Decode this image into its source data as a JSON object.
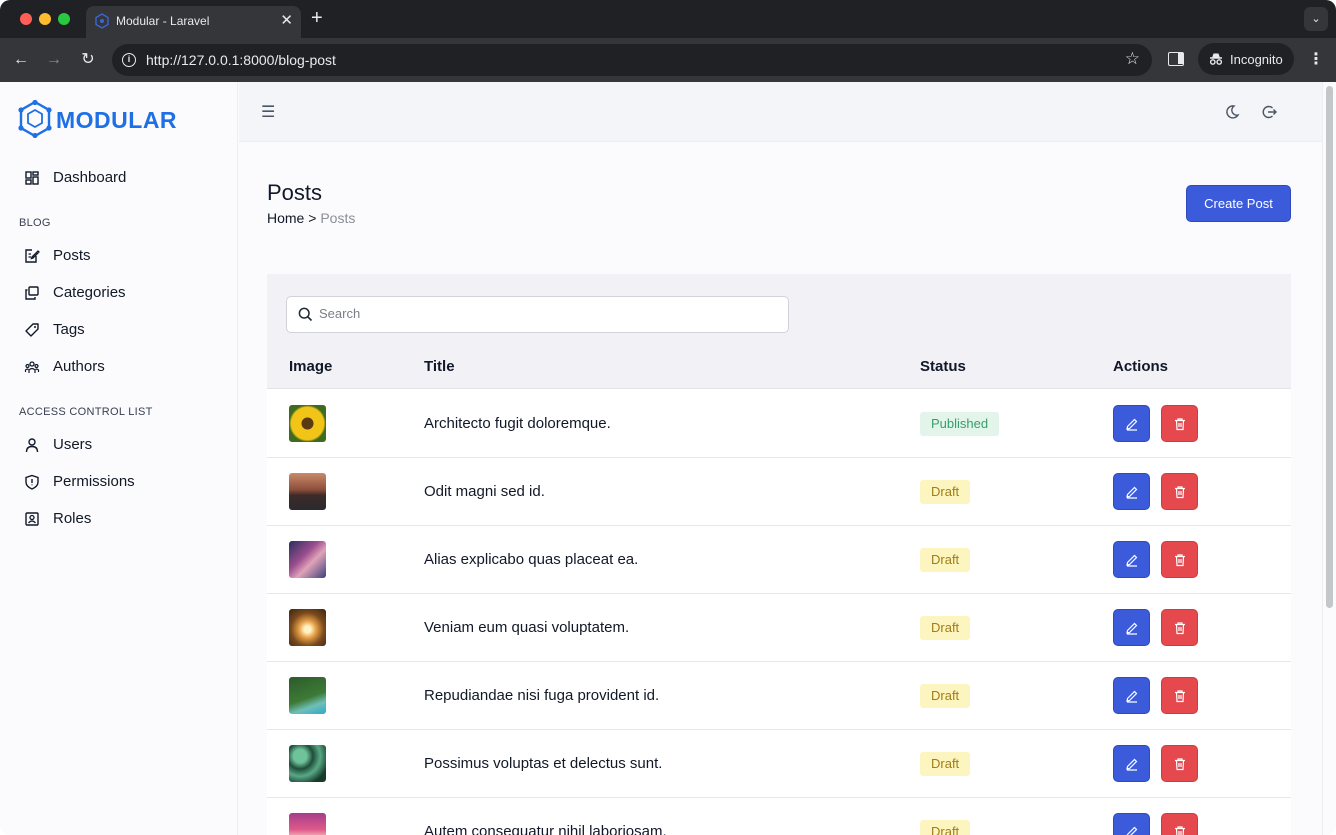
{
  "browser": {
    "tab_title": "Modular - Laravel",
    "tab_close": "✕",
    "new_tab": "+",
    "url": "http://127.0.0.1:8000/blog-post",
    "profile_label": "Incognito"
  },
  "sidebar": {
    "logo_text": "MODULAR",
    "dashboard": "Dashboard",
    "sections": [
      "BLOG",
      "ACCESS CONTROL LIST"
    ],
    "blog_items": [
      {
        "label": "Posts",
        "icon": "edit-note-icon"
      },
      {
        "label": "Categories",
        "icon": "copy-icon"
      },
      {
        "label": "Tags",
        "icon": "tag-icon"
      },
      {
        "label": "Authors",
        "icon": "users-group-icon"
      }
    ],
    "acl_items": [
      {
        "label": "Users",
        "icon": "user-icon"
      },
      {
        "label": "Permissions",
        "icon": "shield-icon"
      },
      {
        "label": "Roles",
        "icon": "id-badge-icon"
      }
    ]
  },
  "header": {
    "menu_icon": "hamburger-icon",
    "theme_icon": "moon-icon",
    "logout_icon": "logout-icon"
  },
  "page": {
    "title": "Posts",
    "breadcrumb_home": "Home",
    "breadcrumb_sep": ">",
    "breadcrumb_current": "Posts",
    "create_button": "Create Post"
  },
  "table": {
    "search_placeholder": "Search",
    "columns": [
      "Image",
      "Title",
      "Status",
      "Actions"
    ],
    "rows": [
      {
        "title": "Architecto fugit doloremque.",
        "status": "Published",
        "image": "sunflower"
      },
      {
        "title": "Odit magni sed id.",
        "status": "Draft",
        "image": "road"
      },
      {
        "title": "Alias explicabo quas placeat ea.",
        "status": "Draft",
        "image": "abstract-purple"
      },
      {
        "title": "Veniam eum quasi voluptatem.",
        "status": "Draft",
        "image": "tunnel"
      },
      {
        "title": "Repudiandae nisi fuga provident id.",
        "status": "Draft",
        "image": "coast-aerial"
      },
      {
        "title": "Possimus voluptas et delectus sunt.",
        "status": "Draft",
        "image": "leaves"
      },
      {
        "title": "Autem consequatur nihil laboriosam.",
        "status": "Draft",
        "image": "sunset"
      }
    ]
  },
  "colors": {
    "primary": "#3b5bdb",
    "danger": "#e5484d",
    "brand": "#1f6fe5",
    "published_bg": "#e3f4ea",
    "published_text": "#35a06a",
    "draft_bg": "#fdf5bf",
    "draft_text": "#a07d16"
  }
}
